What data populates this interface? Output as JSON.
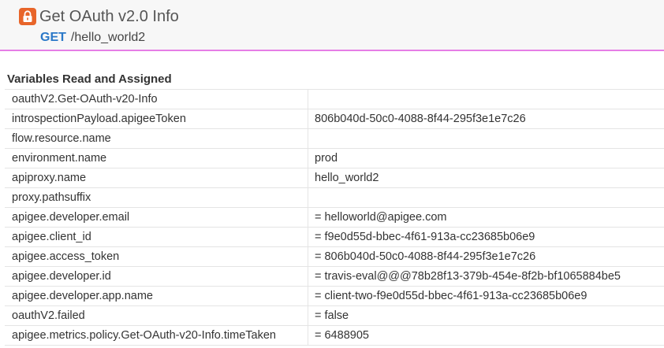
{
  "header": {
    "title": "Get OAuth v2.0 Info",
    "verb": "GET",
    "path": "/hello_world2",
    "icon": "lock-icon",
    "icon_color": "#e8652a"
  },
  "section": {
    "title": "Variables Read and Assigned"
  },
  "variables": [
    {
      "name": "oauthV2.Get-OAuth-v20-Info",
      "value": ""
    },
    {
      "name": "introspectionPayload.apigeeToken",
      "value": "806b040d-50c0-4088-8f44-295f3e1e7c26"
    },
    {
      "name": "flow.resource.name",
      "value": ""
    },
    {
      "name": "environment.name",
      "value": "prod"
    },
    {
      "name": "apiproxy.name",
      "value": "hello_world2"
    },
    {
      "name": "proxy.pathsuffix",
      "value": ""
    },
    {
      "name": "apigee.developer.email",
      "value": "= helloworld@apigee.com"
    },
    {
      "name": "apigee.client_id",
      "value": "= f9e0d55d-bbec-4f61-913a-cc23685b06e9"
    },
    {
      "name": "apigee.access_token",
      "value": "= 806b040d-50c0-4088-8f44-295f3e1e7c26"
    },
    {
      "name": "apigee.developer.id",
      "value": "= travis-eval@@@78b28f13-379b-454e-8f2b-bf1065884be5"
    },
    {
      "name": "apigee.developer.app.name",
      "value": "= client-two-f9e0d55d-bbec-4f61-913a-cc23685b06e9"
    },
    {
      "name": "oauthV2.failed",
      "value": "= false"
    },
    {
      "name": "apigee.metrics.policy.Get-OAuth-v20-Info.timeTaken",
      "value": "= 6488905"
    }
  ]
}
